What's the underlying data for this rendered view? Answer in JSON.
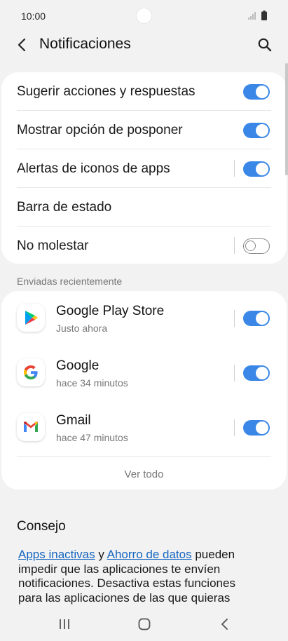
{
  "status_bar": {
    "time": "10:00"
  },
  "header": {
    "title": "Notificaciones"
  },
  "settings": {
    "items": [
      {
        "label": "Sugerir acciones y respuestas",
        "toggle": "on"
      },
      {
        "label": "Mostrar opción de posponer",
        "toggle": "on"
      },
      {
        "label": "Alertas de iconos de apps",
        "toggle": "on"
      },
      {
        "label": "Barra de estado"
      },
      {
        "label": "No molestar",
        "toggle": "off"
      }
    ]
  },
  "recent": {
    "heading": "Enviadas recientemente",
    "apps": [
      {
        "name": "Google Play Store",
        "time": "Justo ahora",
        "icon": "google-play-store-icon",
        "toggle": "on"
      },
      {
        "name": "Google",
        "time": "hace 34 minutos",
        "icon": "google-icon",
        "toggle": "on"
      },
      {
        "name": "Gmail",
        "time": "hace 47 minutos",
        "icon": "gmail-icon",
        "toggle": "on"
      }
    ],
    "see_all": "Ver todo"
  },
  "tip": {
    "title": "Consejo",
    "link1": "Apps inactivas",
    "connector": " y ",
    "link2": "Ahorro de datos",
    "body_rest": " pueden impedir que las aplicaciones te envíen notificaciones. Desactiva estas funciones para las aplicaciones de las que quieras recibir"
  },
  "colors": {
    "accent": "#3a87e8",
    "link": "#1565c0",
    "background": "#f2f2f2",
    "card": "#ffffff"
  }
}
